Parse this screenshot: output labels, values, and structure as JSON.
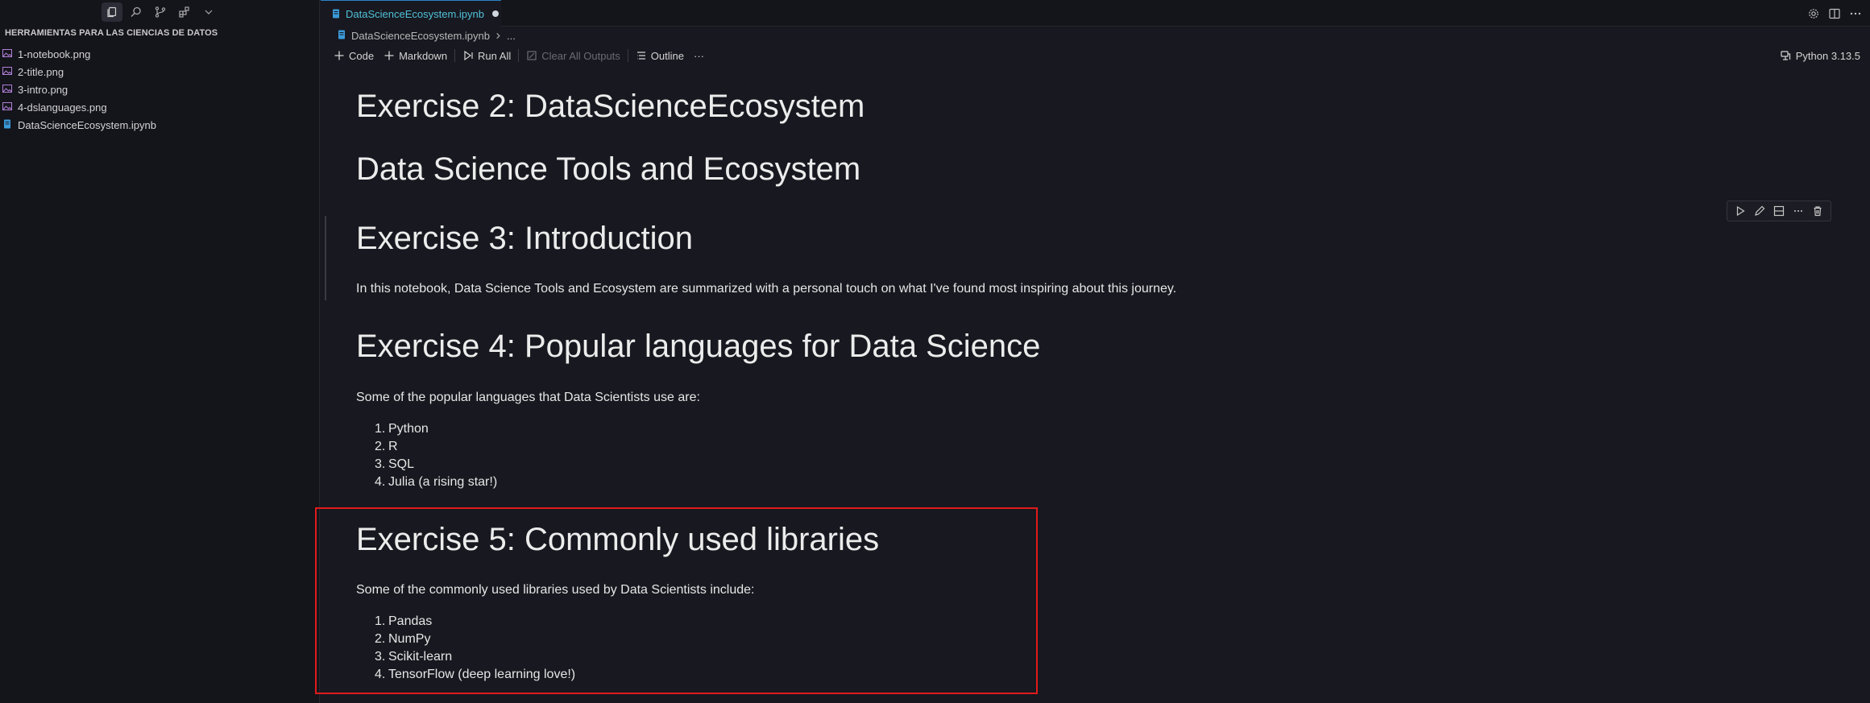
{
  "sidebar": {
    "activity_icons": [
      "explorer-icon",
      "search-icon",
      "source-control-icon",
      "extensions-icon",
      "chevron-down-icon"
    ],
    "explorer_title": "HERRAMIENTAS PARA LAS CIENCIAS DE DATOS",
    "files": [
      {
        "name": "1-notebook.png",
        "type": "image"
      },
      {
        "name": "2-title.png",
        "type": "image"
      },
      {
        "name": "3-intro.png",
        "type": "image"
      },
      {
        "name": "4-dslanguages.png",
        "type": "image"
      },
      {
        "name": "DataScienceEcosystem.ipynb",
        "type": "notebook"
      }
    ]
  },
  "tab": {
    "title": "DataScienceEcosystem.ipynb",
    "modified": true
  },
  "breadcrumb": {
    "file": "DataScienceEcosystem.ipynb",
    "rest": "..."
  },
  "toolbar": {
    "code": "Code",
    "markdown": "Markdown",
    "run_all": "Run All",
    "clear_outputs": "Clear All Outputs",
    "outline": "Outline",
    "more": "···"
  },
  "kernel": "Python 3.13.5",
  "notebook": {
    "h_ex2": "Exercise 2: DataScienceEcosystem",
    "h_title": "Data Science Tools and Ecosystem",
    "h_ex3": "Exercise 3: Introduction",
    "intro": "In this notebook, Data Science Tools and Ecosystem are summarized with a personal touch on what I've found most inspiring about this journey.",
    "h_ex4": "Exercise 4: Popular languages for Data Science",
    "languages_intro": "Some of the popular languages that Data Scientists use are:",
    "languages": [
      "Python",
      "R",
      "SQL",
      "Julia (a rising star!)"
    ],
    "h_ex5": "Exercise 5: Commonly used libraries",
    "libraries_intro": "Some of the commonly used libraries used by Data Scientists include:",
    "libraries": [
      "Pandas",
      "NumPy",
      "Scikit-learn",
      "TensorFlow (deep learning love!)"
    ]
  },
  "colors": {
    "background": "#181820",
    "sidebar": "#14141b",
    "tab_text": "#4fc1d8",
    "highlight": "#e01b1b",
    "image_icon": "#b180d7",
    "notebook_icon": "#3a9ad9"
  }
}
